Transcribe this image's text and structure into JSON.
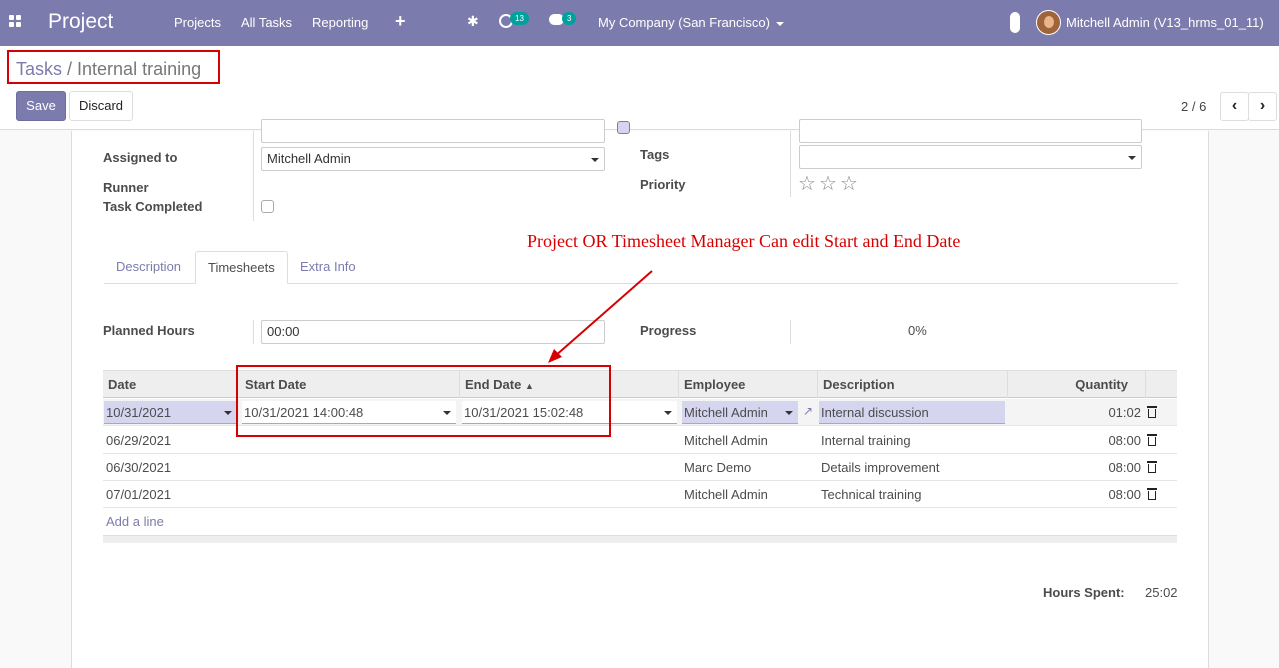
{
  "navbar": {
    "brand": "Project",
    "menu": [
      "Projects",
      "All Tasks",
      "Reporting"
    ],
    "activity_count": "13",
    "message_count": "3",
    "company": "My Company (San Francisco)",
    "user": "Mitchell Admin (V13_hrms_01_11)"
  },
  "breadcrumb": {
    "parent": "Tasks",
    "separator": "/",
    "current": "Internal training"
  },
  "buttons": {
    "save": "Save",
    "discard": "Discard"
  },
  "pager": {
    "value": "2 / 6"
  },
  "form": {
    "assigned_to_label": "Assigned to",
    "assigned_to_value": "Mitchell Admin",
    "runner_label": "Runner",
    "task_completed_label": "Task Completed",
    "tags_label": "Tags",
    "priority_label": "Priority"
  },
  "tabs": [
    "Description",
    "Timesheets",
    "Extra Info"
  ],
  "annotation": "Project OR Timesheet Manager Can edit Start and End Date",
  "timesheet": {
    "planned_hours_label": "Planned Hours",
    "planned_hours_value": "00:00",
    "progress_label": "Progress",
    "progress_value": "0%",
    "columns": [
      "Date",
      "Start Date",
      "End Date",
      "Employee",
      "Description",
      "Quantity"
    ],
    "rows": [
      {
        "date": "10/31/2021",
        "start": "10/31/2021 14:00:48",
        "end": "10/31/2021 15:02:48",
        "employee": "Mitchell Admin",
        "description": "Internal discussion",
        "quantity": "01:02"
      },
      {
        "date": "06/29/2021",
        "start": "",
        "end": "",
        "employee": "Mitchell Admin",
        "description": "Internal training",
        "quantity": "08:00"
      },
      {
        "date": "06/30/2021",
        "start": "",
        "end": "",
        "employee": "Marc Demo",
        "description": "Details improvement",
        "quantity": "08:00"
      },
      {
        "date": "07/01/2021",
        "start": "",
        "end": "",
        "employee": "Mitchell Admin",
        "description": "Technical training",
        "quantity": "08:00"
      }
    ],
    "add_line": "Add a line",
    "hours_spent_label": "Hours Spent:",
    "hours_spent_value": "25:02"
  },
  "colors": {
    "primary": "#7c7bad",
    "annotation": "#d60000",
    "highlight": "#d6d5f0"
  }
}
